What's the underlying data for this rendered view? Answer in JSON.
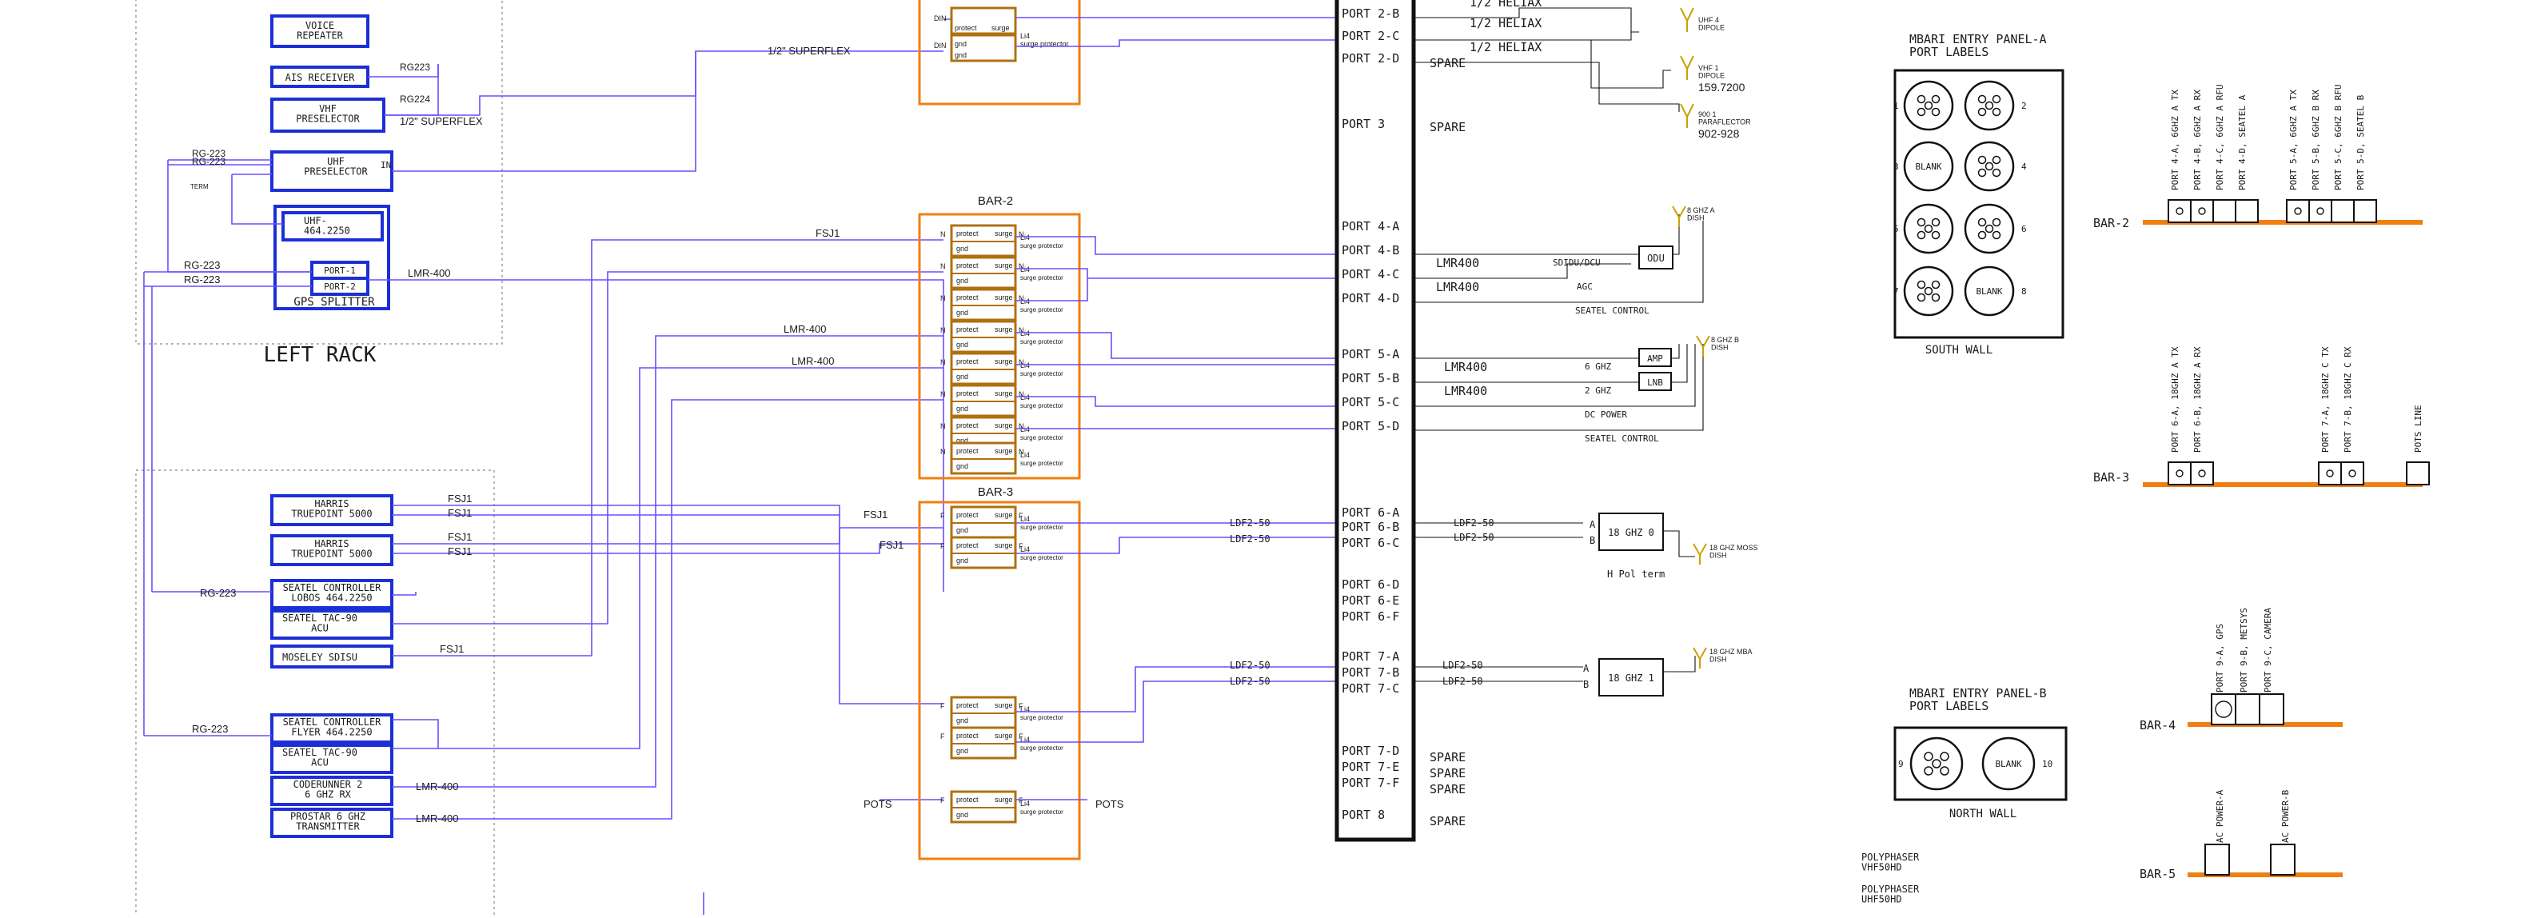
{
  "colors": {
    "wire": "#6f4cff",
    "device_border": "#1c2fd6",
    "bar": "#f07f12",
    "protector": "#b07010",
    "antenna": "#c9a100"
  },
  "left_rack": {
    "label": "LEFT RACK",
    "devices": {
      "voice_repeater": "VOICE\nREPEATER",
      "ais_receiver": "AIS RECEIVER",
      "vhf_preselector": "VHF\nPRESELECTOR",
      "uhf_preselector": "UHF\nPRESELECTOR",
      "uhf_freq": "UHF-\n464.2250",
      "port1": "PORT-1",
      "port2": "PORT-2",
      "gps_splitter": "GPS SPLITTER",
      "uhf_in": "IN",
      "term": "TERM"
    }
  },
  "lower_rack": {
    "devices": {
      "harris1": "HARRIS\nTRUEPOINT 5000",
      "harris2": "HARRIS\nTRUEPOINT 5000",
      "seatel_ctrl_lobos": "SEATEL CONTROLLER\nLOBOS 464.2250",
      "seatel_tac_1": "SEATEL TAC-90\nACU",
      "moseley": "MOSELEY SDISU",
      "seatel_ctrl_flyer": "SEATEL CONTROLLER\nFLYER 464.2250",
      "seatel_tac_2": "SEATEL TAC-90\nACU",
      "coderunner": "CODERUNNER 2\n6 GHZ RX",
      "prostar": "PROSTAR 6 GHZ\nTRANSMITTER"
    }
  },
  "cables": {
    "rg223": "RG223",
    "rg224": "RG224",
    "rg_223": "RG-223",
    "rg_22x": "RG-223",
    "superflex_half": "1/2\" SUPERFLEX",
    "lmr400": "LMR-400",
    "fsj1": "FSJ1",
    "ldf2_50": "LDF2-50",
    "lmr400_b": "LMR400",
    "pots": "POTS"
  },
  "protectors": {
    "protect": "protect",
    "surge": "surge",
    "gnd": "gnd",
    "li4": "Li4",
    "surge_protector": "surge protector",
    "n": "N",
    "din": "DIN",
    "f": "F"
  },
  "bars": {
    "bar2": "BAR-2",
    "bar3": "BAR-3"
  },
  "ports": [
    "PORT 2-B",
    "PORT 2-C",
    "PORT 2-D",
    "PORT 3",
    "PORT 4-A",
    "PORT 4-B",
    "PORT 4-C",
    "PORT 4-D",
    "PORT 5-A",
    "PORT 5-B",
    "PORT 5-C",
    "PORT 5-D",
    "PORT 6-A",
    "PORT 6-B",
    "PORT 6-C",
    "PORT 6-D",
    "PORT 6-E",
    "PORT 6-F",
    "PORT 7-A",
    "PORT 7-B",
    "PORT 7-C",
    "PORT 7-D",
    "PORT 7-E",
    "PORT 7-F",
    "PORT 8"
  ],
  "port_notes": {
    "heliax_half": "1/2 HELIAX",
    "spare": "SPARE"
  },
  "antennas": {
    "uhf4": "UHF 4\nDIPOLE",
    "vhf1": "VHF 1\nDIPOLE",
    "vhf1_freq": "159.7200",
    "p900": "900 1\nPARAFLECTOR",
    "p900_freq": "902-928",
    "d8a": "8 GHZ A\nDISH",
    "d8b": "8 GHZ B\nDISH",
    "d18moss": "18 GHZ MOSS\nDISH",
    "d18mba": "18 GHZ MBA\nDISH"
  },
  "outdoor": {
    "odu": "ODU",
    "amp": "AMP",
    "lnb": "LNB",
    "sdidu": "SDIDU/DCU",
    "agc": "AGC",
    "seatel_control": "SEATEL CONTROL",
    "ghz6": "6 GHZ",
    "ghz2": "2 GHZ",
    "dc_power": "DC POWER",
    "radio18a": "18 GHZ 0",
    "radio18b": "18 GHZ 1",
    "a": "A",
    "b": "B",
    "hpol": "H Pol term"
  },
  "panel_a": {
    "title": "MBARI ENTRY PANEL-A\nPORT LABELS",
    "wall": "SOUTH WALL",
    "blank": "BLANK",
    "numbers": [
      "1",
      "2",
      "3",
      "4",
      "5",
      "6",
      "7",
      "8"
    ],
    "bar2_labels": [
      "PORT 4-A, 6GHZ A TX",
      "PORT 4-B, 6GHZ A RX",
      "PORT 4-C, 6GHZ A RFU",
      "PORT 4-D, SEATEL A",
      "PORT 5-A, 6GHZ A TX",
      "PORT 5-B, 6GHZ B RX",
      "PORT 5-C, 6GHZ B RFU",
      "PORT 5-D, SEATEL B"
    ],
    "bar3_labels": [
      "PORT 6-A, 18GHZ A TX",
      "PORT 6-B, 18GHZ A RX",
      "PORT 7-A, 18GHZ C TX",
      "PORT 7-B, 18GHZ C RX",
      "POTS LINE"
    ]
  },
  "panel_b": {
    "title": "MBARI ENTRY PANEL-B\nPORT LABELS",
    "wall": "NORTH WALL",
    "blank": "BLANK",
    "numbers": [
      "9",
      "10"
    ],
    "bar4": "BAR-4",
    "bar5": "BAR-5",
    "bar4_labels": [
      "PORT 9-A, GPS",
      "PORT 9-B, METSYS",
      "PORT 9-C, CAMERA"
    ],
    "bar5_labels": [
      "AC POWER-A",
      "AC POWER-B"
    ]
  },
  "polyphaser": [
    "POLYPHASER\nVHF50HD",
    "POLYPHASER\nUHF50HD"
  ]
}
